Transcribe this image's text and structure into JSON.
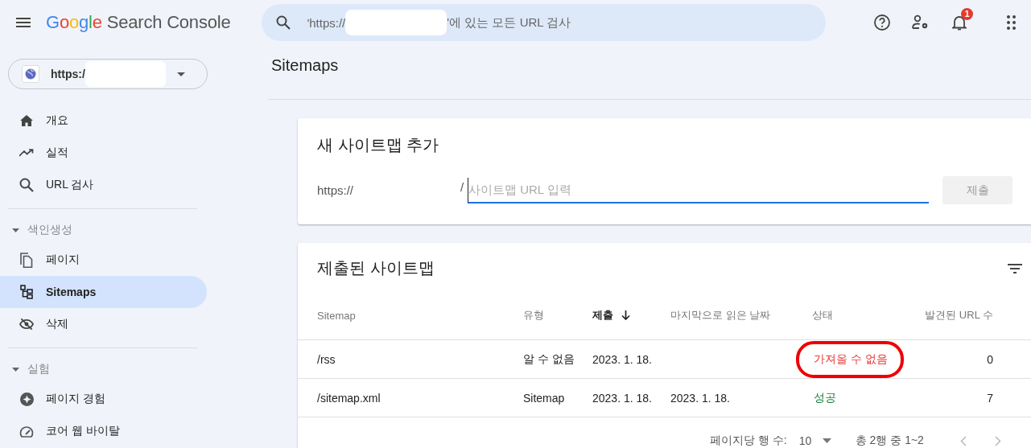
{
  "header": {
    "product": "Google",
    "product_suffix": "Search Console",
    "search": {
      "placeholder_before": "'https://",
      "placeholder_after": "'에 있는 모든 URL 검사"
    },
    "notification_count": "1"
  },
  "property": {
    "label": "https:/"
  },
  "sidebar": {
    "items": [
      {
        "kind": "item",
        "label": "개요",
        "selected": false
      },
      {
        "kind": "item",
        "label": "실적",
        "selected": false
      },
      {
        "kind": "item",
        "label": "URL 검사",
        "selected": false
      },
      {
        "kind": "section",
        "label": "색인생성",
        "expanded": true,
        "children": [
          {
            "kind": "item",
            "label": "페이지",
            "selected": false
          },
          {
            "kind": "item",
            "label": "Sitemaps",
            "selected": true
          },
          {
            "kind": "item",
            "label": "삭제",
            "selected": false
          }
        ]
      },
      {
        "kind": "section",
        "label": "실험",
        "expanded": true,
        "children": [
          {
            "kind": "item",
            "label": "페이지 경험",
            "selected": false
          },
          {
            "kind": "item",
            "label": "코어 웹 바이탈",
            "selected": false
          }
        ]
      }
    ]
  },
  "page_title": "Sitemaps",
  "add_card": {
    "title": "새 사이트맵 추가",
    "prefix": "https://",
    "separator": "/",
    "input": {
      "placeholder": "사이트맵 URL 입력"
    },
    "submit": {
      "label": "제출",
      "disabled": true
    }
  },
  "list_card": {
    "title": "제출된 사이트맵",
    "columns": [
      {
        "label": "Sitemap",
        "sorted": false
      },
      {
        "label": "유형",
        "sorted": false
      },
      {
        "label": "제출",
        "sorted": true
      },
      {
        "label": "마지막으로 읽은 날짜",
        "sorted": false
      },
      {
        "label": "상태",
        "sorted": false
      },
      {
        "label": "발견된 URL 수",
        "sorted": false
      }
    ],
    "rows": [
      {
        "sitemap": "/rss",
        "type": "알 수 없음",
        "submitted": "2023. 1. 18.",
        "last_read": "",
        "status": {
          "label": "가져올 수 없음",
          "kind": "error",
          "circled": true
        },
        "urls": "0"
      },
      {
        "sitemap": "/sitemap.xml",
        "type": "Sitemap",
        "submitted": "2023. 1. 18.",
        "last_read": "2023. 1. 18.",
        "status": {
          "label": "성공",
          "kind": "success",
          "circled": false
        },
        "urls": "7"
      }
    ],
    "footer": {
      "rows_per_page_label": "페이지당 행 수:",
      "rows_per_page": "10",
      "range": "총 2행 중 1~2"
    }
  }
}
